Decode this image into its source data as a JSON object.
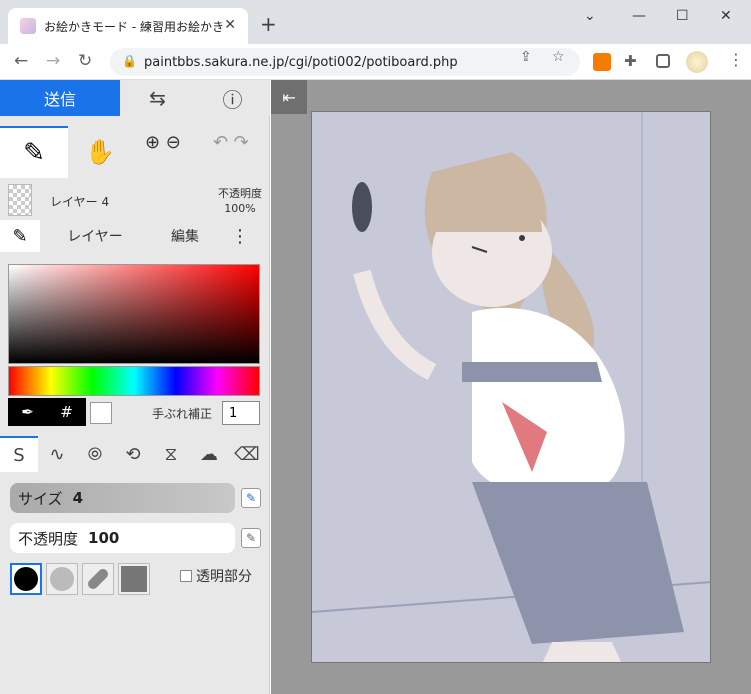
{
  "browser": {
    "tab_title": "お絵かきモード - 練習用お絵かき掲示",
    "url": "paintbbs.sakura.ne.jp/cgi/poti002/potiboard.php"
  },
  "app": {
    "send_label": "送信",
    "layer_name": "レイヤー 4",
    "opacity_title": "不透明度",
    "opacity_value": "100%",
    "tabs": [
      "レイヤー",
      "編集"
    ],
    "hash_label": "#",
    "stabilizer_label": "手ぶれ補正",
    "stabilizer_value": "1",
    "size_label": "サイズ",
    "size_value": "4",
    "brush_opacity_label": "不透明度",
    "brush_opacity_value": "100",
    "transparent_label": "透明部分"
  },
  "colors": {
    "accent": "#1a73e8",
    "canvas_bg": "#c7c9d9",
    "panel_bg": "#e8e8e8"
  },
  "icons": {
    "collapse": "arrow-left-to-line-icon",
    "swap": "swap-icon",
    "help": "help-icon"
  }
}
